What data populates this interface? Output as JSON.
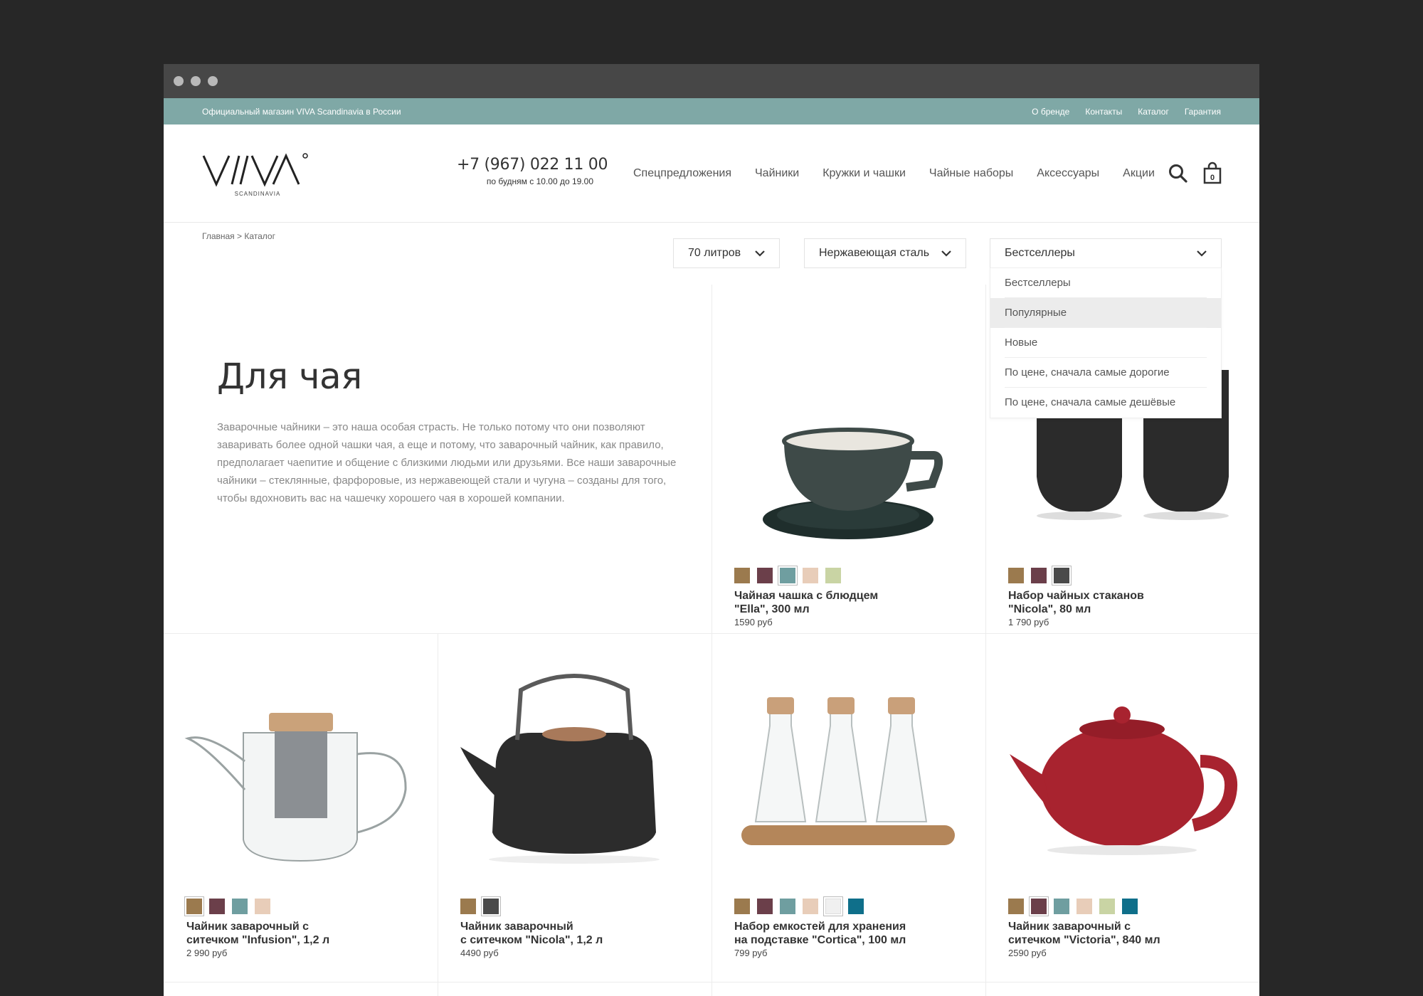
{
  "topbar": {
    "tagline": "Официальный магазин VIVA Scandinavia в России",
    "links": [
      "О бренде",
      "Контакты",
      "Каталог",
      "Гарантия"
    ]
  },
  "header": {
    "logo_text": "VIVA",
    "logo_sub": "SCANDINAVIA",
    "phone": "+7 (967) 022 11 00",
    "hours": "по будням с 10.00 до 19.00",
    "nav": [
      "Спецпредложения",
      "Чайники",
      "Кружки и чашки",
      "Чайные наборы",
      "Аксессуары",
      "Акции"
    ],
    "cart_count": "0",
    "icons": {
      "search": "search-icon",
      "cart": "shopping-bag-icon"
    }
  },
  "breadcrumb": "Главная > Каталог",
  "filters": {
    "volume": "70 литров",
    "material": "Нержавеющая сталь",
    "sort": "Бестселлеры"
  },
  "sort_options": [
    {
      "label": "Бестселлеры",
      "active": false
    },
    {
      "label": "Популярные",
      "active": true
    },
    {
      "label": "Новые",
      "active": false
    },
    {
      "label": "По цене, сначала самые дорогие",
      "active": false
    },
    {
      "label": "По цене, сначала самые дешёвые",
      "active": false
    }
  ],
  "intro": {
    "title": "Для чая",
    "text": "Заварочные чайники – это наша особая страсть. Не только потому что они позволяют заваривать более одной чашки чая, а еще и потому, что заварочный чайник, как правило, предполагает чаепитие и общение с близкими людьми или друзьями. Все наши заварочные чайники – стеклянные, фарфоровые, из нержавеющей стали и чугуна – созданы для того, чтобы вдохновить вас на чашечку хорошего чая в хорошей компании."
  },
  "products": [
    {
      "name": "Чайная чашка с блюдцем\n\"Ella\", 300 мл",
      "price": "1590 руб",
      "image": "cup-saucer",
      "swatches": [
        "#9b7a4e",
        "#6b3f4a",
        "#6f9ea0",
        "#e8cdb9",
        "#c9d4a4"
      ],
      "selected_swatch": 2
    },
    {
      "name": "Набор чайных стаканов\n\"Nicola\", 80 мл",
      "price": "1 790 руб",
      "image": "cups-pair",
      "swatches": [
        "#9b7a4e",
        "#6b3f4a",
        "#4a4a4a"
      ],
      "selected_swatch": 2
    },
    {
      "name": "Чайник заварочный с\nситечком \"Infusion\", 1,2 л",
      "price": "2 990 руб",
      "image": "glass-teapot",
      "swatches": [
        "#9b7a4e",
        "#6b3f4a",
        "#6f9ea0",
        "#e8cdb9"
      ],
      "selected_swatch": 0
    },
    {
      "name": "Чайник заварочный\nс ситечком \"Nicola\", 1,2 л",
      "price": "4490 руб",
      "image": "black-teapot",
      "swatches": [
        "#9b7a4e",
        "#4a4a4a"
      ],
      "selected_swatch": 1
    },
    {
      "name": "Набор емкостей для хранения\nна подставке \"Cortica\", 100 мл",
      "price": "799 руб",
      "image": "glass-jars",
      "swatches": [
        "#9b7a4e",
        "#6b3f4a",
        "#6f9ea0",
        "#e8cdb9",
        "#f0f0f0",
        "#0f6f8a"
      ],
      "selected_swatch": 4
    },
    {
      "name": "Чайник заварочный с\nситечком \"Victoria\", 840 мл",
      "price": "2590 руб",
      "image": "red-teapot",
      "swatches": [
        "#9b7a4e",
        "#6b3f4a",
        "#6f9ea0",
        "#e8cdb9",
        "#c9d4a4",
        "#0f6f8a"
      ],
      "selected_swatch": 1
    }
  ]
}
